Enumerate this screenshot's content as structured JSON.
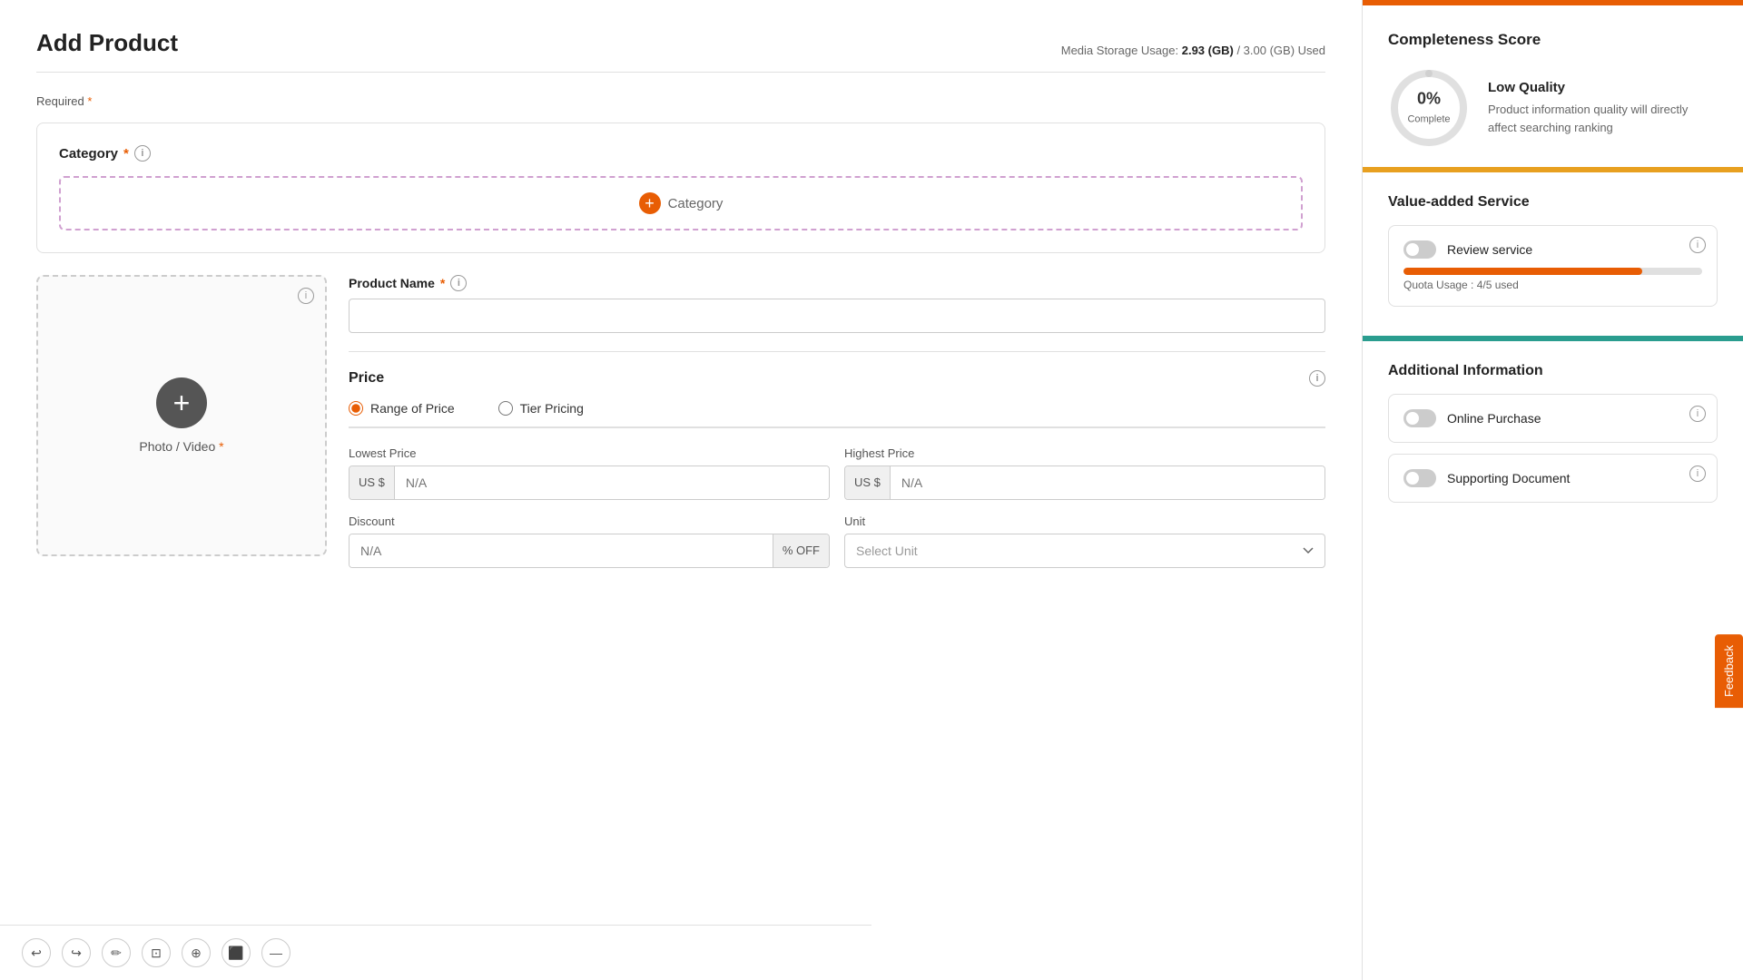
{
  "page": {
    "title": "Add Product",
    "storage_label": "Media Storage Usage:",
    "storage_used": "2.93 (GB)",
    "storage_total": "3.00 (GB) Used"
  },
  "required": {
    "label": "Required"
  },
  "category": {
    "label": "Category",
    "btn_label": "Category"
  },
  "photo": {
    "label": "Photo / Video"
  },
  "product_name": {
    "label": "Product Name",
    "placeholder": ""
  },
  "price": {
    "label": "Price",
    "range_label": "Range of Price",
    "tier_label": "Tier Pricing",
    "lowest_label": "Lowest Price",
    "highest_label": "Highest Price",
    "currency": "US $",
    "placeholder": "N/A",
    "discount_label": "Discount",
    "discount_placeholder": "N/A",
    "discount_suffix": "% OFF",
    "unit_label": "Unit",
    "unit_placeholder": "Select Unit"
  },
  "sidebar": {
    "completeness": {
      "title": "Completeness Score",
      "percent": "0%",
      "complete_label": "Complete",
      "quality_title": "Low Quality",
      "quality_desc": "Product information quality will directly affect searching ranking"
    },
    "vas": {
      "title": "Value-added Service",
      "review": {
        "name": "Review service",
        "quota_text": "Quota Usage : 4/5 used"
      }
    },
    "additional": {
      "title": "Additional Information",
      "online_purchase": "Online Purchase",
      "supporting_doc": "Supporting Document"
    }
  },
  "toolbar": {
    "icons": [
      "↩",
      "↪",
      "✏",
      "⊡",
      "🔍",
      "⬛",
      "—"
    ]
  },
  "feedback": {
    "label": "Feedback"
  }
}
